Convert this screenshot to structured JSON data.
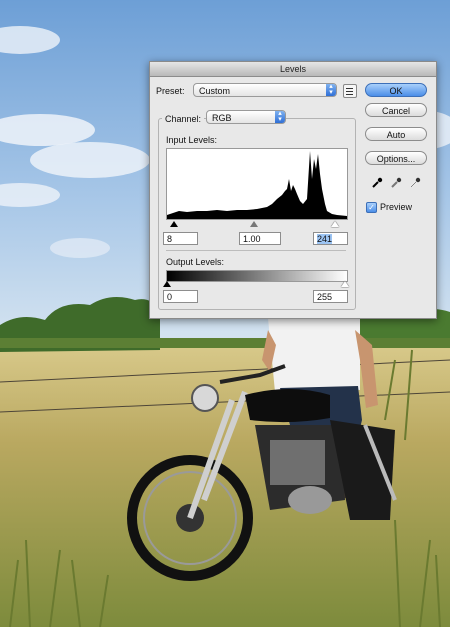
{
  "dialog": {
    "title": "Levels",
    "preset_label": "Preset:",
    "preset_value": "Custom",
    "channel_label": "Channel:",
    "channel_value": "RGB",
    "input_levels_label": "Input Levels:",
    "input_black": "8",
    "input_gamma": "1.00",
    "input_white": "241",
    "output_levels_label": "Output Levels:",
    "output_black": "0",
    "output_white": "255",
    "buttons": {
      "ok": "OK",
      "cancel": "Cancel",
      "auto": "Auto",
      "options": "Options..."
    },
    "preview_label": "Preview",
    "preview_checked": true
  },
  "icons": [
    "preset-menu-icon",
    "black-eyedropper-icon",
    "gray-eyedropper-icon",
    "white-eyedropper-icon",
    "check-icon"
  ]
}
